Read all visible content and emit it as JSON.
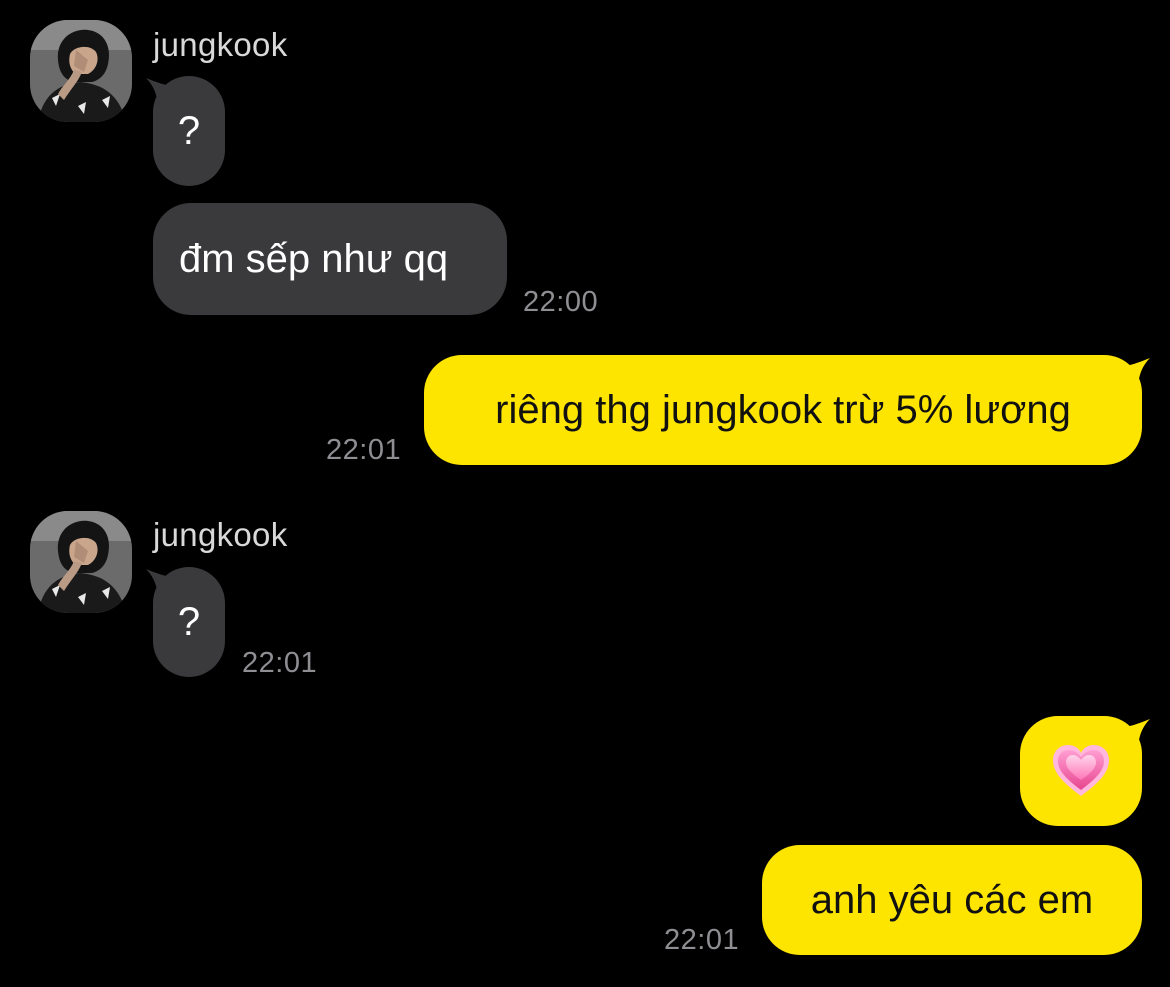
{
  "chat": {
    "messages": [
      {
        "direction": "incoming",
        "sender": "jungkook",
        "text": "?"
      },
      {
        "direction": "incoming",
        "text": "đm sếp như qq",
        "time": "22:00"
      },
      {
        "direction": "outgoing",
        "text": "riêng thg jungkook trừ 5% lương",
        "time": "22:01"
      },
      {
        "direction": "incoming",
        "sender": "jungkook",
        "text": "?",
        "time": "22:01"
      },
      {
        "direction": "outgoing",
        "emoji": "growing-heart-emoji"
      },
      {
        "direction": "outgoing",
        "text": "anh yêu các em",
        "time": "22:01"
      }
    ]
  },
  "colors": {
    "background": "#000000",
    "incoming_bubble": "#3a3a3c",
    "outgoing_bubble": "#fee500",
    "timestamp": "#8e8e93",
    "sender_name": "#d9d9d9"
  }
}
